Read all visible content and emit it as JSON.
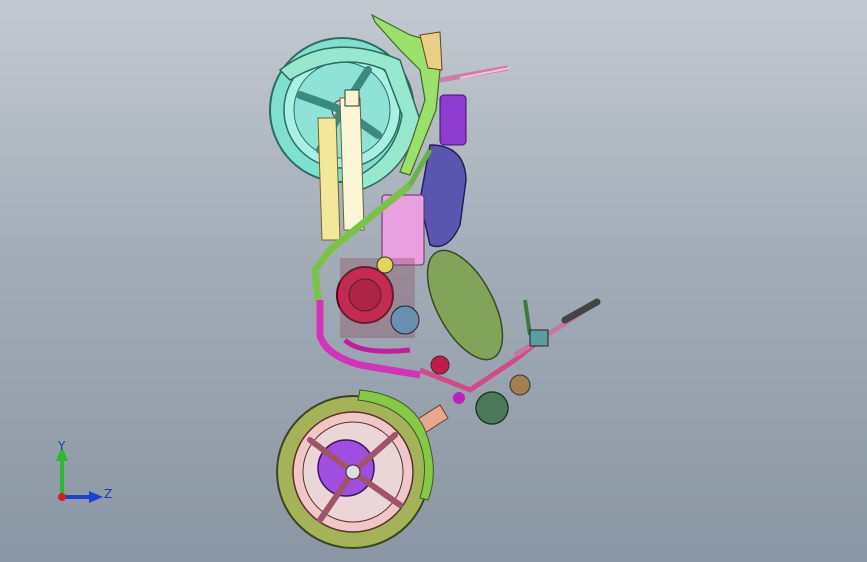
{
  "viewport": {
    "background_top": "#c3c9d0",
    "background_bottom": "#8b96a4"
  },
  "model": {
    "icon": "motorcycle-cad-assembly"
  },
  "triad": {
    "y_label": "Y",
    "z_label": "Z",
    "y_color": "#2db82d",
    "z_color": "#1f3fd0",
    "x_color": "#d02020"
  }
}
